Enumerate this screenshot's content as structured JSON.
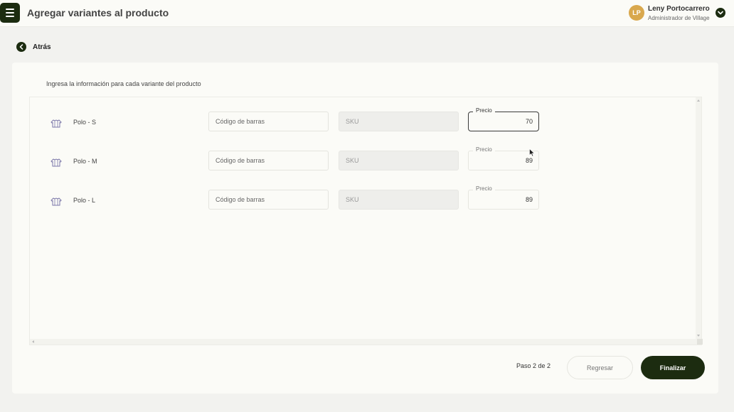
{
  "header": {
    "title": "Agregar variantes al producto",
    "menu_icon": "hamburger-icon"
  },
  "user": {
    "initials": "LP",
    "name": "Leny Portocarrero",
    "role": "Administrador de Village",
    "avatar_color": "#d9a84d"
  },
  "nav": {
    "back_label": "Atrás"
  },
  "form": {
    "instruction": "Ingresa la información para cada variante del producto",
    "barcode_placeholder": "Código de barras",
    "sku_placeholder": "SKU",
    "price_label": "Precio",
    "variants": [
      {
        "name": "Polo - S",
        "price": "70",
        "price_focused": true
      },
      {
        "name": "Polo - M",
        "price": "89",
        "price_focused": false
      },
      {
        "name": "Polo - L",
        "price": "89",
        "price_focused": false
      }
    ]
  },
  "footer": {
    "step": "Paso 2 de 2",
    "back_button": "Regresar",
    "finish_button": "Finalizar"
  },
  "colors": {
    "primary": "#1c2c10",
    "background": "#f2f2ef",
    "surface": "#fbfbf7"
  }
}
